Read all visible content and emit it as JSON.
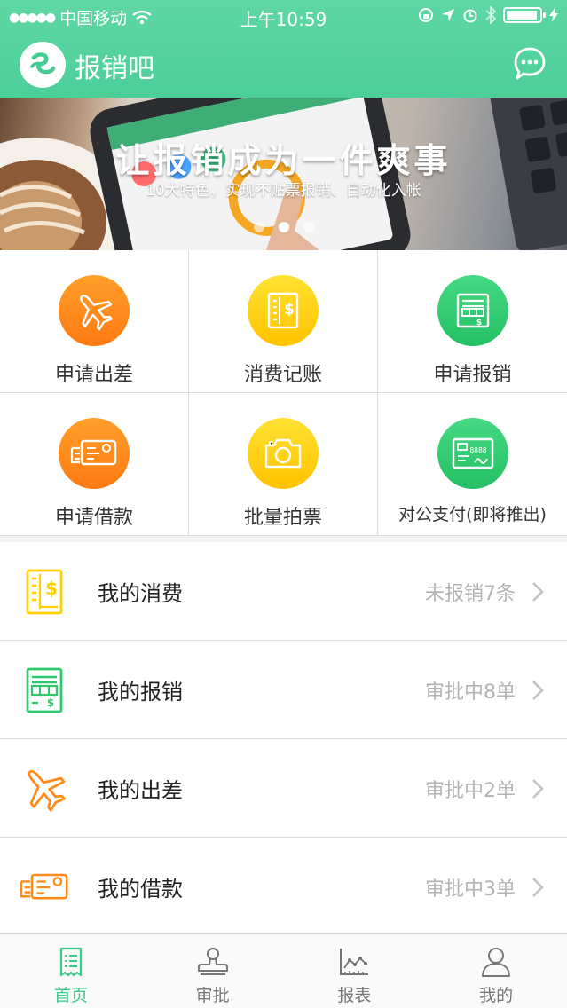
{
  "status_bar": {
    "carrier": "中国移动",
    "time": "上午10:59"
  },
  "header": {
    "app_title": "报销吧",
    "logo_icon": "app-logo-icon",
    "chat_icon": "chat-icon"
  },
  "banner": {
    "headline": "让报销成为一件爽事",
    "subline": "10大特色，实现不贴票报销、自动化入帐",
    "pages": 3,
    "active_page": 2
  },
  "quick_actions": [
    {
      "label": "申请出差",
      "icon": "airplane-icon",
      "color": "#ff8c1a"
    },
    {
      "label": "消费记账",
      "icon": "receipt-dollar-icon",
      "color": "#ffd000"
    },
    {
      "label": "申请报销",
      "icon": "invoice-icon",
      "color": "#2fc86c"
    },
    {
      "label": "申请借款",
      "icon": "loan-card-icon",
      "color": "#ff8c1a"
    },
    {
      "label": "批量拍票",
      "icon": "camera-icon",
      "color": "#ffd000"
    },
    {
      "label": "对公支付(即将推出)",
      "icon": "check-payment-icon",
      "color": "#2fc86c"
    }
  ],
  "list": [
    {
      "label": "我的消费",
      "value": "未报销7条",
      "icon": "receipt-dollar-icon",
      "color": "#ffd000"
    },
    {
      "label": "我的报销",
      "value": "审批中8单",
      "icon": "invoice-icon",
      "color": "#2fc86c"
    },
    {
      "label": "我的出差",
      "value": "审批中2单",
      "icon": "airplane-icon",
      "color": "#ff8c1a"
    },
    {
      "label": "我的借款",
      "value": "审批中3单",
      "icon": "loan-card-icon",
      "color": "#ff8c1a"
    }
  ],
  "tabs": [
    {
      "label": "首页",
      "icon": "home-receipt-icon",
      "active": true
    },
    {
      "label": "审批",
      "icon": "stamp-icon",
      "active": false
    },
    {
      "label": "报表",
      "icon": "chart-icon",
      "active": false
    },
    {
      "label": "我的",
      "icon": "user-icon",
      "active": false
    }
  ],
  "colors": {
    "brand": "#4ccf98",
    "active_tab": "#3cc98b",
    "muted_text": "#b3b3b3"
  }
}
